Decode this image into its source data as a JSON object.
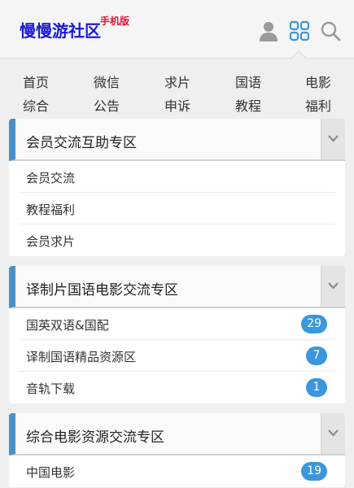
{
  "header": {
    "logo_text": "慢慢游社区",
    "logo_sub": "手机版",
    "icons": [
      "user-icon",
      "grid-icon",
      "search-icon"
    ]
  },
  "nav": {
    "row1": [
      "首页",
      "微信",
      "求片",
      "国语",
      "电影"
    ],
    "row2": [
      "综合",
      "公告",
      "申诉",
      "教程",
      "福利"
    ]
  },
  "sections": [
    {
      "title": "会员交流互助专区",
      "items": [
        {
          "label": "会员交流"
        },
        {
          "label": "教程福利"
        },
        {
          "label": "会员求片"
        }
      ]
    },
    {
      "title": "译制片国语电影交流专区",
      "items": [
        {
          "label": "国英双语&国配",
          "count": "29"
        },
        {
          "label": "译制国语精品资源区",
          "count": "7"
        },
        {
          "label": "音轨下载",
          "count": "1"
        }
      ]
    },
    {
      "title": "综合电影资源交流专区",
      "items": [
        {
          "label": "中国电影",
          "count": "19"
        }
      ]
    }
  ],
  "colors": {
    "accent": "#4a90c8",
    "badge": "#3a97dc",
    "logo": "#1a1ad6",
    "logo_sub": "#e0173a"
  }
}
